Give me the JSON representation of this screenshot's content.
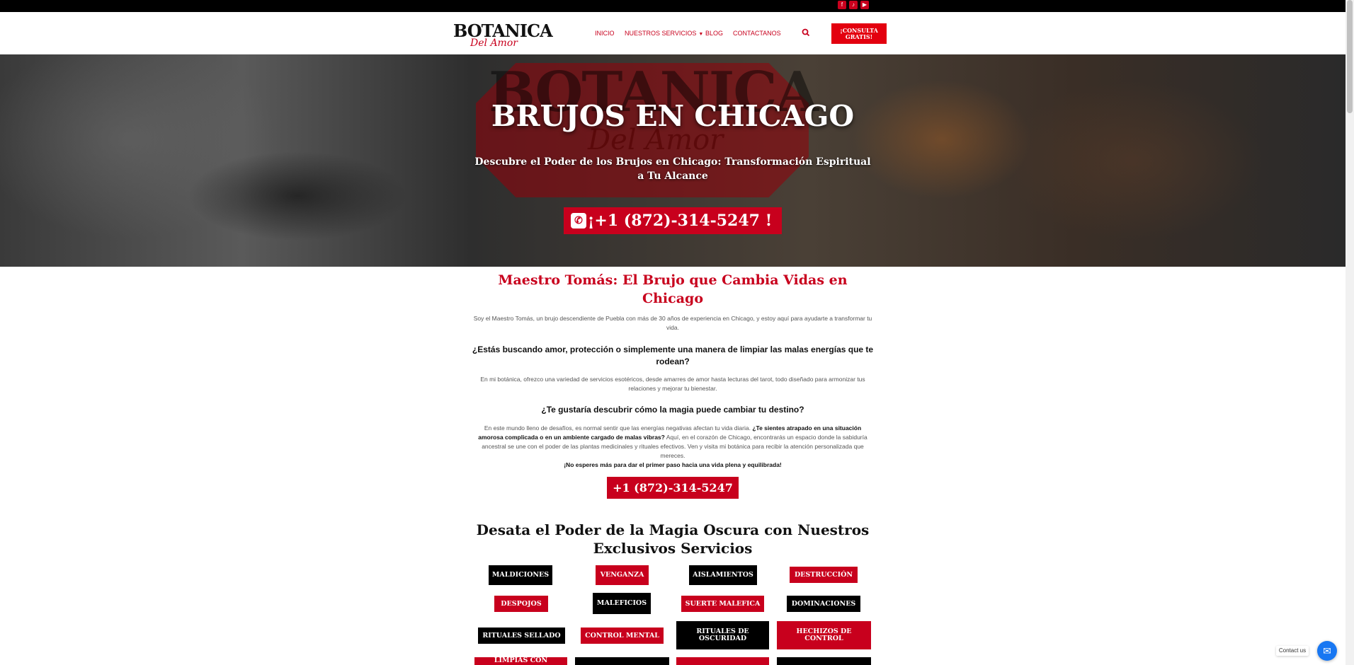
{
  "topbar": {
    "social_icons": [
      "facebook-icon",
      "tiktok-icon",
      "youtube-icon"
    ]
  },
  "header": {
    "logo_main": "BOTANICA",
    "logo_sub": "Del Amor",
    "nav": [
      {
        "label": "INICIO"
      },
      {
        "label": "NUESTROS SERVICIOS",
        "dropdown": true
      },
      {
        "label": "BLOG"
      },
      {
        "label": "CONTACTANOS"
      }
    ],
    "cta_label": "¡CONSULTA GRATIS!"
  },
  "hero": {
    "watermark_main": "BOTANICA",
    "watermark_sub": "Del Amor",
    "title": "BRUJOS EN CHICAGO",
    "subtitle": "Descubre el Poder de los Brujos en Chicago: Transformación Espiritual a Tu Alcance",
    "phone_label": "¡+1 (872)-314-5247 !"
  },
  "intro": {
    "title": "Maestro Tomás: El Brujo que Cambia Vidas en Chicago",
    "para1": "Soy el Maestro Tomás, un brujo descendiente de Puebla con más de 30 años de experiencia en Chicago, y estoy aquí para ayudarte a transformar tu vida.",
    "question1": "¿Estás buscando amor, protección o simplemente una manera de limpiar las malas energías que te rodean?",
    "para2": "En mi botánica, ofrezco una variedad de servicios esotéricos, desde amarres de amor hasta lecturas del tarot, todo diseñado para armonizar tus relaciones y mejorar tu bienestar.",
    "question2": "¿Te gustaría descubrir cómo la magia puede cambiar tu destino?",
    "para3_start": "En este mundo lleno de desafíos, es normal sentir que las energías negativas afectan tu vida diaria. ",
    "para3_bold": "¿Te sientes atrapado en una situación amorosa complicada o en un ambiente cargado de malas vibras?",
    "para3_end": " Aquí, en el corazón de Chicago, encontrarás un espacio donde la sabiduría ancestral se une con el poder de las plantas medicinales y rituales efectivos. Ven y visita mi botánica para recibir la atención personalizada que mereces.",
    "para3_final": "¡No esperes más para dar el primer paso hacia una vida plena y equilibrada!",
    "phone_button": "+1 (872)-314-5247"
  },
  "services": {
    "title": "Desata el Poder de la Magia Oscura con Nuestros Exclusivos Servicios",
    "items": [
      {
        "label": "MALDICIONES",
        "color": "#000000"
      },
      {
        "label": "VENGANZA",
        "color": "#c8001d"
      },
      {
        "label": "AISLAMIENTOS",
        "color": "#000000"
      },
      {
        "label": "DESTRUCCIÓN",
        "color": "#c8001d"
      },
      {
        "label": "DESPOJOS",
        "color": "#c8001d"
      },
      {
        "label": "MALEFICIOS",
        "color": "#000000"
      },
      {
        "label": "SUERTE MALEFICA",
        "color": "#c8001d"
      },
      {
        "label": "DOMINACIONES",
        "color": "#000000"
      },
      {
        "label": "RITUALES SELLADO",
        "color": "#000000"
      },
      {
        "label": "CONTROL MENTAL",
        "color": "#c8001d"
      },
      {
        "label": "RITUALES DE OSCURIDAD",
        "color": "#000000"
      },
      {
        "label": "HECHIZOS DE CONTROL",
        "color": "#c8001d"
      },
      {
        "label": "LIMPIAS CON",
        "color": "#c8001d"
      },
      {
        "label": "",
        "color": "#000000"
      },
      {
        "label": "",
        "color": "#c8001d"
      },
      {
        "label": "",
        "color": "#000000"
      }
    ]
  },
  "chat": {
    "label": "Contact us",
    "icon": "messenger-icon"
  },
  "colors": {
    "accent": "#c8001d",
    "cta": "#e3000f",
    "dark": "#000000"
  }
}
